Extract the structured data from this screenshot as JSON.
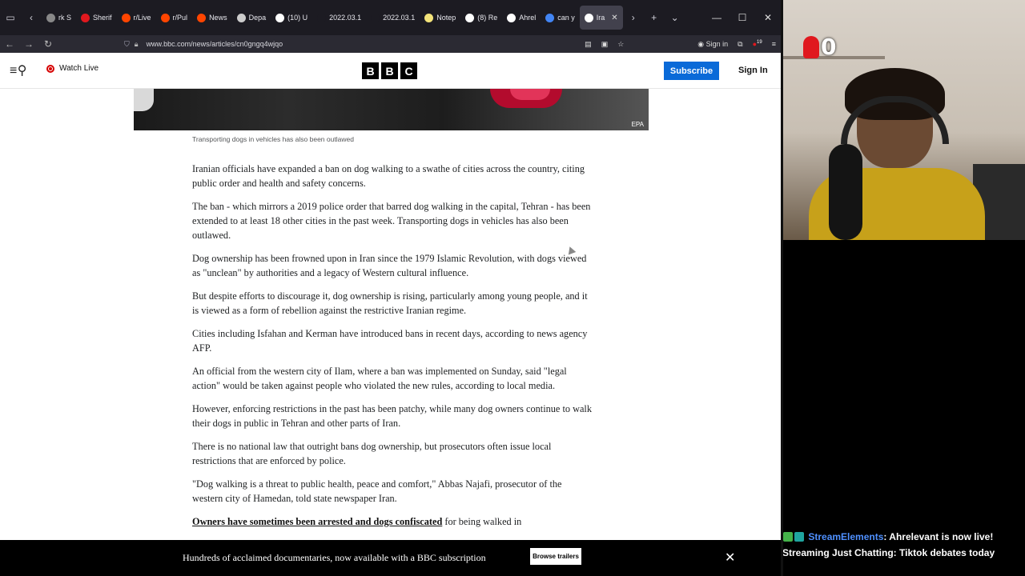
{
  "browser": {
    "tabs": [
      {
        "label": "rk S",
        "color": "#888888"
      },
      {
        "label": "Sherif",
        "color": "#e0181e"
      },
      {
        "label": "r/Live",
        "color": "#ff4500"
      },
      {
        "label": "r/Pul",
        "color": "#ff4500"
      },
      {
        "label": "News",
        "color": "#ff4500"
      },
      {
        "label": "Depa",
        "color": "#cccccc"
      },
      {
        "label": "(10) U",
        "color": "#ffffff"
      },
      {
        "label": "2022.03.1",
        "color": "#1c1b22"
      },
      {
        "label": "2022.03.1",
        "color": "#1c1b22"
      },
      {
        "label": "Notep",
        "color": "#f3e37a"
      },
      {
        "label": "(8) Re",
        "color": "#ffffff"
      },
      {
        "label": "Ahrel",
        "color": "#ffffff"
      },
      {
        "label": "can y",
        "color": "#4285f4"
      },
      {
        "label": "Ira",
        "color": "#ffffff"
      }
    ],
    "url": "www.bbc.com/news/articles/cn0gngq4wjqo",
    "sign_in": "Sign in",
    "extension_badge": "19"
  },
  "bbc": {
    "watch_live": "Watch Live",
    "logo_letters": [
      "B",
      "B",
      "C"
    ],
    "subscribe": "Subscribe",
    "sign_in": "Sign In",
    "image_credit": "EPA",
    "caption": "Transporting dogs in vehicles has also been outlawed",
    "paragraphs": [
      "Iranian officials have expanded a ban on dog walking to a swathe of cities across the country, citing public order and health and safety concerns.",
      "The ban - which mirrors a 2019 police order that barred dog walking in the capital, Tehran - has been extended to at least 18 other cities in the past week. Transporting dogs in vehicles has also been outlawed.",
      "Dog ownership has been frowned upon in Iran since the 1979 Islamic Revolution, with dogs viewed as \"unclean\" by authorities and a legacy of Western cultural influence.",
      "But despite efforts to discourage it, dog ownership is rising, particularly among young people, and it is viewed as a form of rebellion against the restrictive Iranian regime.",
      "Cities including Isfahan and Kerman have introduced bans in recent days, according to news agency AFP.",
      "An official from the western city of Ilam, where a ban was implemented on Sunday, said \"legal action\" would be taken against people who violated the new rules, according to local media.",
      "However, enforcing restrictions in the past has been patchy, while many dog owners continue to walk their dogs in public in Tehran and other parts of Iran.",
      "There is no national law that outright bans dog ownership, but prosecutors often issue local restrictions that are enforced by police.",
      "\"Dog walking is a threat to public health, peace and comfort,\" Abbas Najafi, prosecutor of the western city of Hamedan, told state newspaper Iran."
    ],
    "last_link": "Owners have sometimes been arrested and dogs confiscated",
    "last_tail": " for being walked in",
    "promo_text": "Hundreds of acclaimed documentaries, now available with a BBC subscription",
    "promo_button": "Browse trailers"
  },
  "stream": {
    "viewer_count": "0",
    "chat_user": "StreamElements",
    "chat_message": ": Ahrelevant is now live!",
    "chat_line2": "Streaming Just Chatting: Tiktok debates today"
  }
}
